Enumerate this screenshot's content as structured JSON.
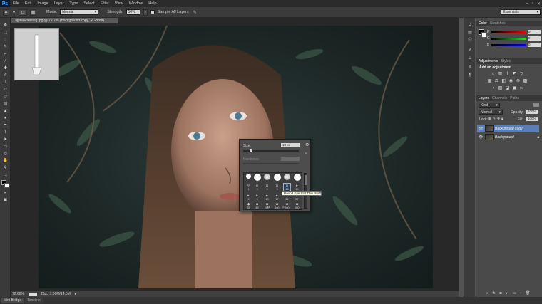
{
  "app": {
    "logo": "Ps"
  },
  "menu": [
    "File",
    "Edit",
    "Image",
    "Layer",
    "Type",
    "Select",
    "Filter",
    "View",
    "Window",
    "Help"
  ],
  "options": {
    "brush_size": "13",
    "mode_label": "Mode:",
    "mode_value": "Normal",
    "strength_label": "Strength:",
    "strength_value": "50%",
    "sample_all_layers": "Sample All Layers",
    "workspace": "Essentials"
  },
  "document": {
    "tab_title": "Digital Painting.jpg @ 72.7% (Background copy, RGB/8#) *",
    "zoom": "72.66%",
    "doc_info": "Doc: 7.00M/14.0M"
  },
  "brush_picker": {
    "size_label": "Size:",
    "size_value": "13 px",
    "hardness_label": "Hardness:",
    "tip_numbers": [
      "1",
      "3",
      "5",
      "9",
      "13",
      "19",
      "5",
      "9",
      "13",
      "17",
      "21",
      "27",
      "35",
      "45",
      "65",
      "100",
      "200",
      "300",
      "14",
      "24"
    ],
    "tooltip": "Round Fan Stiff Thin Bristles"
  },
  "color_panel": {
    "tabs": [
      "Color",
      "Swatches"
    ],
    "r": "0",
    "g": "0",
    "b": "0",
    "r_label": "R",
    "g_label": "G",
    "b_label": "B"
  },
  "adjustments_panel": {
    "tabs": [
      "Adjustments",
      "Styles"
    ],
    "heading": "Add an adjustment"
  },
  "layers_panel": {
    "tabs": [
      "Layers",
      "Channels",
      "Paths"
    ],
    "kind": "Kind",
    "blend_mode": "Normal",
    "opacity_label": "Opacity:",
    "opacity_value": "100%",
    "lock_label": "Lock:",
    "fill_label": "Fill:",
    "fill_value": "100%",
    "layers": [
      {
        "name": "Background copy",
        "selected": true
      },
      {
        "name": "Background",
        "selected": false
      }
    ]
  },
  "bottom_tabs": [
    "Mini Bridge",
    "Timeline"
  ],
  "icons": {
    "eye": "eye-icon",
    "lock": "lock-icon",
    "tool_icon": "blur-tool-icon"
  }
}
